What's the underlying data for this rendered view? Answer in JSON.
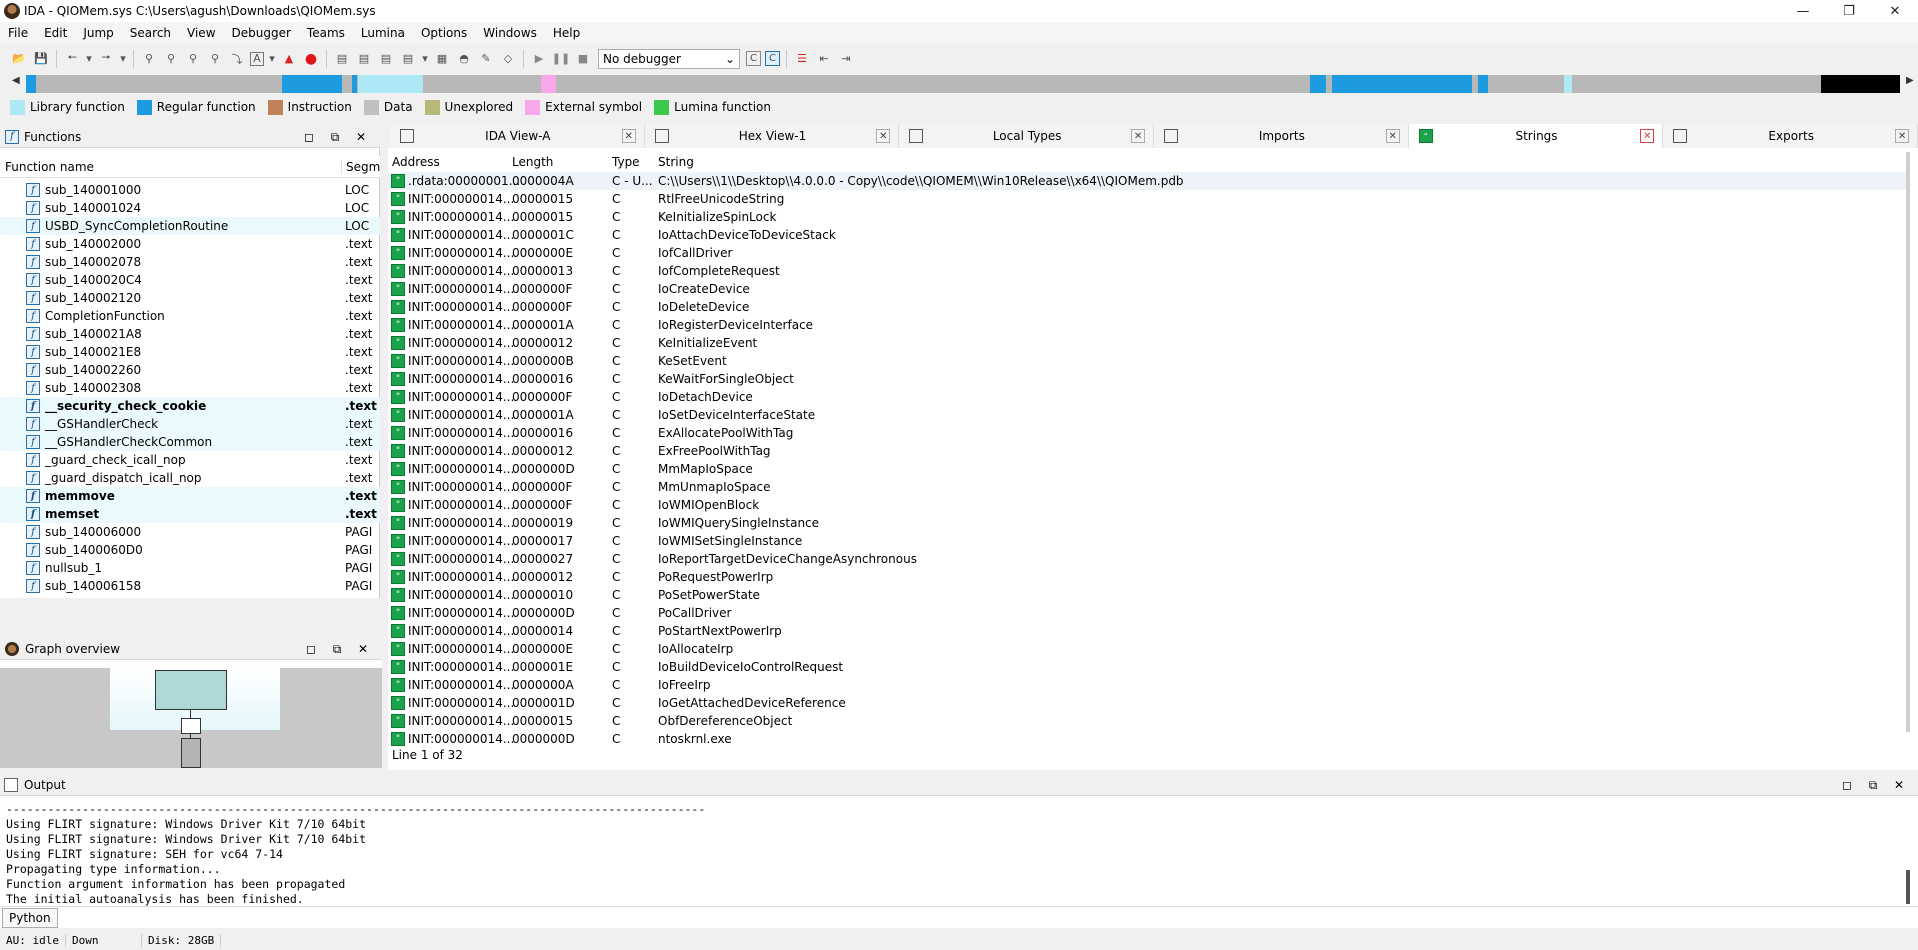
{
  "window": {
    "title": "IDA - QIOMem.sys C:\\Users\\agush\\Downloads\\QIOMem.sys",
    "minimize": "—",
    "maximize": "❐",
    "close": "✕"
  },
  "menu": [
    "File",
    "Edit",
    "Jump",
    "Search",
    "View",
    "Debugger",
    "Teams",
    "Lumina",
    "Options",
    "Windows",
    "Help"
  ],
  "toolbar": {
    "debugger_select": "No debugger"
  },
  "legend": [
    {
      "label": "Library function",
      "color": "#aee8f5"
    },
    {
      "label": "Regular function",
      "color": "#1e9be0"
    },
    {
      "label": "Instruction",
      "color": "#c0805a"
    },
    {
      "label": "Data",
      "color": "#c0c0c0"
    },
    {
      "label": "Unexplored",
      "color": "#b8b878"
    },
    {
      "label": "External symbol",
      "color": "#f7a8e8"
    },
    {
      "label": "Lumina function",
      "color": "#3cc84a"
    }
  ],
  "functions": {
    "title": "Functions",
    "col_name": "Function name",
    "col_segment": "Segm",
    "rows": [
      {
        "name": "sub_140001000",
        "seg": "LOC",
        "type": "plain"
      },
      {
        "name": "sub_140001024",
        "seg": "LOC",
        "type": "plain"
      },
      {
        "name": "USBD_SyncCompletionRoutine",
        "seg": "LOC",
        "type": "lib"
      },
      {
        "name": "sub_140002000",
        "seg": ".text",
        "type": "plain"
      },
      {
        "name": "sub_140002078",
        "seg": ".text",
        "type": "plain"
      },
      {
        "name": "sub_1400020C4",
        "seg": ".text",
        "type": "plain"
      },
      {
        "name": "sub_140002120",
        "seg": ".text",
        "type": "plain"
      },
      {
        "name": "CompletionFunction",
        "seg": ".text",
        "type": "plain"
      },
      {
        "name": "sub_1400021A8",
        "seg": ".text",
        "type": "plain"
      },
      {
        "name": "sub_1400021E8",
        "seg": ".text",
        "type": "plain"
      },
      {
        "name": "sub_140002260",
        "seg": ".text",
        "type": "plain"
      },
      {
        "name": "sub_140002308",
        "seg": ".text",
        "type": "plain"
      },
      {
        "name": "__security_check_cookie",
        "seg": ".text",
        "type": "libbold"
      },
      {
        "name": "__GSHandlerCheck",
        "seg": ".text",
        "type": "lib"
      },
      {
        "name": "__GSHandlerCheckCommon",
        "seg": ".text",
        "type": "lib"
      },
      {
        "name": "_guard_check_icall_nop",
        "seg": ".text",
        "type": "plain"
      },
      {
        "name": "_guard_dispatch_icall_nop",
        "seg": ".text",
        "type": "plain"
      },
      {
        "name": "memmove",
        "seg": ".text",
        "type": "libbold"
      },
      {
        "name": "memset",
        "seg": ".text",
        "type": "libbold"
      },
      {
        "name": "sub_140006000",
        "seg": "PAGI",
        "type": "plain"
      },
      {
        "name": "sub_1400060D0",
        "seg": "PAGI",
        "type": "plain"
      },
      {
        "name": "nullsub_1",
        "seg": "PAGI",
        "type": "plain"
      },
      {
        "name": "sub_140006158",
        "seg": "PAGI",
        "type": "plain"
      }
    ]
  },
  "graph": {
    "title": "Graph overview"
  },
  "tabs": [
    {
      "label": "IDA View-A",
      "icon": "disassembly-icon",
      "active": false
    },
    {
      "label": "Hex View-1",
      "icon": "hex-icon",
      "active": false
    },
    {
      "label": "Local Types",
      "icon": "types-icon",
      "active": false
    },
    {
      "label": "Imports",
      "icon": "imports-icon",
      "active": false
    },
    {
      "label": "Strings",
      "icon": "strings-icon",
      "active": true
    },
    {
      "label": "Exports",
      "icon": "exports-icon",
      "active": false
    }
  ],
  "strings": {
    "headers": [
      "Address",
      "Length",
      "Type",
      "String"
    ],
    "rows": [
      [
        ".rdata:00000001...",
        "0000004A",
        "C - U...",
        "C:\\\\Users\\\\1\\\\Desktop\\\\4.0.0.0 - Copy\\\\code\\\\QIOMEM\\\\Win10Release\\\\x64\\\\QIOMem.pdb"
      ],
      [
        "INIT:000000014...",
        "00000015",
        "C",
        "RtlFreeUnicodeString"
      ],
      [
        "INIT:000000014...",
        "00000015",
        "C",
        "KeInitializeSpinLock"
      ],
      [
        "INIT:000000014...",
        "0000001C",
        "C",
        "IoAttachDeviceToDeviceStack"
      ],
      [
        "INIT:000000014...",
        "0000000E",
        "C",
        "IofCallDriver"
      ],
      [
        "INIT:000000014...",
        "00000013",
        "C",
        "IofCompleteRequest"
      ],
      [
        "INIT:000000014...",
        "0000000F",
        "C",
        "IoCreateDevice"
      ],
      [
        "INIT:000000014...",
        "0000000F",
        "C",
        "IoDeleteDevice"
      ],
      [
        "INIT:000000014...",
        "0000001A",
        "C",
        "IoRegisterDeviceInterface"
      ],
      [
        "INIT:000000014...",
        "00000012",
        "C",
        "KeInitializeEvent"
      ],
      [
        "INIT:000000014...",
        "0000000B",
        "C",
        "KeSetEvent"
      ],
      [
        "INIT:000000014...",
        "00000016",
        "C",
        "KeWaitForSingleObject"
      ],
      [
        "INIT:000000014...",
        "0000000F",
        "C",
        "IoDetachDevice"
      ],
      [
        "INIT:000000014...",
        "0000001A",
        "C",
        "IoSetDeviceInterfaceState"
      ],
      [
        "INIT:000000014...",
        "00000016",
        "C",
        "ExAllocatePoolWithTag"
      ],
      [
        "INIT:000000014...",
        "00000012",
        "C",
        "ExFreePoolWithTag"
      ],
      [
        "INIT:000000014...",
        "0000000D",
        "C",
        "MmMapIoSpace"
      ],
      [
        "INIT:000000014...",
        "0000000F",
        "C",
        "MmUnmapIoSpace"
      ],
      [
        "INIT:000000014...",
        "0000000F",
        "C",
        "IoWMIOpenBlock"
      ],
      [
        "INIT:000000014...",
        "00000019",
        "C",
        "IoWMIQuerySingleInstance"
      ],
      [
        "INIT:000000014...",
        "00000017",
        "C",
        "IoWMISetSingleInstance"
      ],
      [
        "INIT:000000014...",
        "00000027",
        "C",
        "IoReportTargetDeviceChangeAsynchronous"
      ],
      [
        "INIT:000000014...",
        "00000012",
        "C",
        "PoRequestPowerIrp"
      ],
      [
        "INIT:000000014...",
        "00000010",
        "C",
        "PoSetPowerState"
      ],
      [
        "INIT:000000014...",
        "0000000D",
        "C",
        "PoCallDriver"
      ],
      [
        "INIT:000000014...",
        "00000014",
        "C",
        "PoStartNextPowerIrp"
      ],
      [
        "INIT:000000014...",
        "0000000E",
        "C",
        "IoAllocateIrp"
      ],
      [
        "INIT:000000014...",
        "0000001E",
        "C",
        "IoBuildDeviceIoControlRequest"
      ],
      [
        "INIT:000000014...",
        "0000000A",
        "C",
        "IoFreeIrp"
      ],
      [
        "INIT:000000014...",
        "0000001D",
        "C",
        "IoGetAttachedDeviceReference"
      ],
      [
        "INIT:000000014...",
        "00000015",
        "C",
        "ObfDereferenceObject"
      ],
      [
        "INIT:000000014...",
        "0000000D",
        "C",
        "ntoskrnl.exe"
      ]
    ],
    "status": "Line 1 of 32"
  },
  "output": {
    "title": "Output",
    "text": "-----------------------------------------------------------------------------------------------------\nUsing FLIRT signature: Windows Driver Kit 7/10 64bit\nUsing FLIRT signature: Windows Driver Kit 7/10 64bit\nUsing FLIRT signature: SEH for vc64 7-14\nPropagating type information...\nFunction argument information has been propagated\nThe initial autoanalysis has been finished."
  },
  "python": {
    "label": "Python"
  },
  "statusbar": {
    "au": "AU:  idle",
    "dir": "Down",
    "disk": "Disk: 28GB"
  }
}
